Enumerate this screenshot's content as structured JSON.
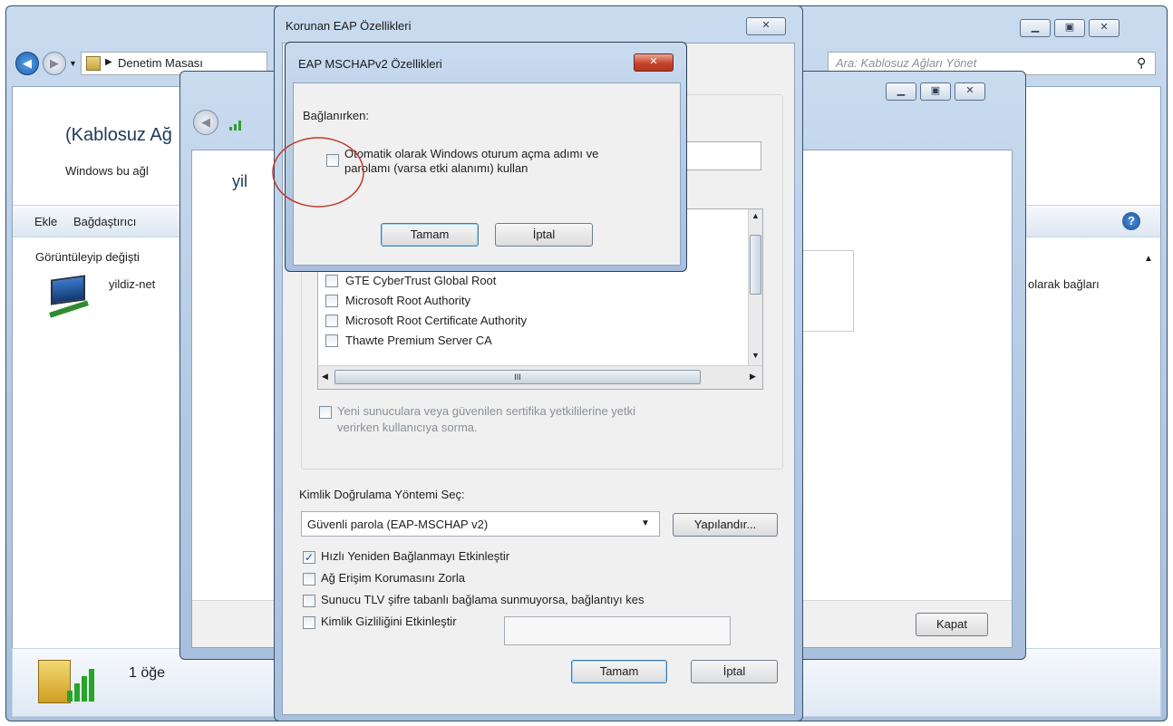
{
  "explorer": {
    "breadcrumb_item": "Denetim Masası",
    "search_placeholder": "Ara: Kablosuz Ağları Yönet",
    "page_title": "(Kablosuz Ağ",
    "page_subtitle": "Windows bu ağl",
    "toolbar": {
      "add_label": "Ekle",
      "adapter_label": "Bağdaştırıcı"
    },
    "view_label": "Görüntüleyip değişti",
    "network_name": "yildiz-net",
    "right_text": "olarak bağları",
    "status_count": "1 öğe"
  },
  "wireless_props": {
    "title": "yil",
    "close_button": "Kapat"
  },
  "eap_props": {
    "title": "Korunan EAP Özellikleri",
    "certificates": [
      "GTE CyberTrust Global Root",
      "Microsoft Root Authority",
      "Microsoft Root Certificate Authority",
      "Thawte Premium Server CA"
    ],
    "scroll_thumb": "III",
    "new_servers_line1": "Yeni sunuculara veya güvenilen sertifika yetkililerine yetki",
    "new_servers_line2": "verirken kullanıcıya sorma.",
    "auth_method_label": "Kimlik Doğrulama Yöntemi Seç:",
    "auth_method_value": "Güvenli parola (EAP-MSCHAP v2)",
    "configure_button": "Yapılandır...",
    "options": [
      {
        "label": "Hızlı Yeniden Bağlanmayı Etkinleştir",
        "checked": true
      },
      {
        "label": "Ağ Erişim Korumasını Zorla",
        "checked": false
      },
      {
        "label": "Sunucu TLV şifre tabanlı bağlama sunmuyorsa, bağlantıyı kes",
        "checked": false
      },
      {
        "label": "Kimlik Gizliliğini Etkinleştir",
        "checked": false
      }
    ],
    "ok_button": "Tamam",
    "cancel_button": "İptal"
  },
  "mschap": {
    "title": "EAP MSCHAPv2 Özellikleri",
    "connecting_label": "Bağlanırken:",
    "auto_logon_line1": "Otomatik olarak Windows oturum açma adımı ve",
    "auto_logon_line2": "parolamı (varsa etki alanımı) kullan",
    "ok_button": "Tamam",
    "cancel_button": "İptal"
  },
  "colors": {
    "frame": "#b2c9e3",
    "close_red": "#c6432b",
    "highlight_circle": "#c0392b",
    "check_blue": "#1d4f91"
  }
}
